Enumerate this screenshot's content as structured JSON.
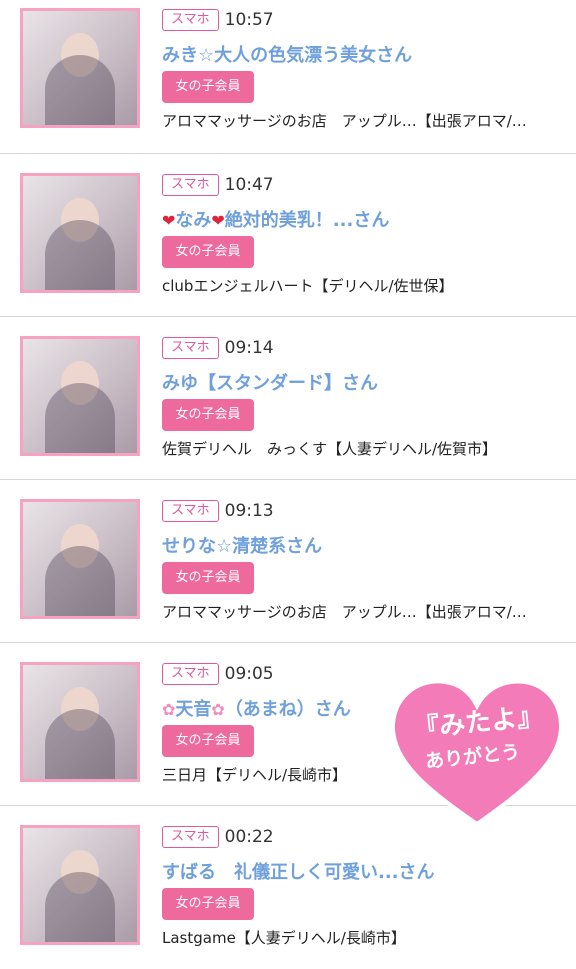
{
  "entries": [
    {
      "device": "スマホ",
      "time": "10:57",
      "name": "みき☆大人の色気漂う美女さん",
      "member": "女の子会員",
      "shop": "アロママッサージのお店　アップル…【出張アロマ/…"
    },
    {
      "device": "スマホ",
      "time": "10:47",
      "icon_left": "heart-icon",
      "name_mid": "なみ",
      "icon_right": "heart-icon",
      "name_tail": "絶対的美乳！...さん",
      "member": "女の子会員",
      "shop": "clubエンジェルハート【デリヘル/佐世保】"
    },
    {
      "device": "スマホ",
      "time": "09:14",
      "name": "みゆ【スタンダード】さん",
      "member": "女の子会員",
      "shop": "佐賀デリヘル　みっくす【人妻デリヘル/佐賀市】"
    },
    {
      "device": "スマホ",
      "time": "09:13",
      "name": "せりな☆清楚系さん",
      "member": "女の子会員",
      "shop": "アロママッサージのお店　アップル…【出張アロマ/…"
    },
    {
      "device": "スマホ",
      "time": "09:05",
      "icon_left": "cherry-blossom-icon",
      "name_mid": "天音",
      "icon_right": "cherry-blossom-icon",
      "name_tail": "（あまね）さん",
      "member": "女の子会員",
      "shop": "三日月【デリヘル/長崎市】"
    },
    {
      "device": "スマホ",
      "time": "00:22",
      "name": "すばる　礼儀正しく可愛い...さん",
      "member": "女の子会員",
      "shop": "Lastgame【人妻デリヘル/長崎市】"
    }
  ],
  "sticker": {
    "line1": "『みたよ』",
    "line2": "ありがとう",
    "color": "#f27bb8"
  },
  "colors": {
    "badge_border": "#e2599a",
    "name": "#6fa0dc",
    "member_bg": "#ee6a9c",
    "thumb_border": "#f5a3c0"
  }
}
